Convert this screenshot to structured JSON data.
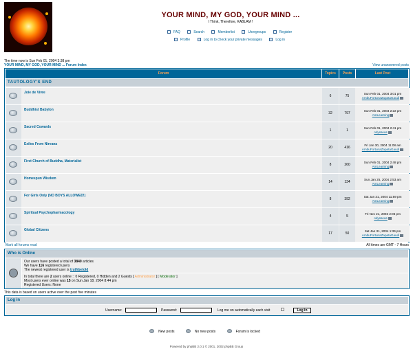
{
  "site": {
    "title": "YOUR MIND, MY GOD, YOUR MIND ...",
    "description": "I Think, Therefore, KABLAM !"
  },
  "nav": {
    "faq": "FAQ",
    "search": "Search",
    "memberlist": "Memberlist",
    "usergroups": "Usergroups",
    "register": "Register",
    "profile": "Profile",
    "messages": "Log in to check your private messages",
    "login": "Log in"
  },
  "timeline": "The time now is Sun Feb 01, 2004 3:38 pm",
  "breadcrumb": "YOUR MIND, MY GOD, YOUR MIND ... Forum Index",
  "unanswered": "View unanswered posts",
  "table": {
    "h_forum": "Forum",
    "h_topics": "Topics",
    "h_posts": "Posts",
    "h_last": "Last Post",
    "category": "TAUTOLOGY'S END"
  },
  "forums": [
    {
      "name": "Joie de Vivre",
      "topics": "6",
      "posts": "75",
      "date": "Sun Feb 01, 2004 3:01 pm",
      "user": "AmbuFortunaZapataGaudi"
    },
    {
      "name": "Buddhist Babylon",
      "topics": "32",
      "posts": "797",
      "date": "Sun Feb 01, 2004 2:22 pm",
      "user": "AmLearning"
    },
    {
      "name": "Sacred Cowards",
      "topics": "1",
      "posts": "1",
      "date": "Sun Feb 01, 2004 2:41 pm",
      "user": "odysseus"
    },
    {
      "name": "Exiles From Nirvana",
      "topics": "20",
      "posts": "416",
      "date": "Fri Jan 30, 2004 11:08 am",
      "user": "AmbuFortunaZapataGaudi"
    },
    {
      "name": "First Church of Buddha, Materialist",
      "topics": "8",
      "posts": "260",
      "date": "Sun Feb 01, 2004 2:48 pm",
      "user": "AmLearning"
    },
    {
      "name": "Homespun Wisdom",
      "topics": "14",
      "posts": "134",
      "date": "Sun Jan 25, 2004 2:53 am",
      "user": "AmLearning"
    },
    {
      "name": "For Girls Only (NO BOYS ALLOWED!)",
      "topics": "8",
      "posts": "392",
      "date": "Sat Jan 31, 2004 11:59 pm",
      "user": "AmLearning"
    },
    {
      "name": "Spiritual Psychopharmacology",
      "topics": "4",
      "posts": "5",
      "date": "Fri Nov 21, 2003 2:06 pm",
      "user": "odysseus"
    },
    {
      "name": "Global Citizens",
      "topics": "17",
      "posts": "50",
      "date": "Sat Jan 31, 2004 1:39 pm",
      "user": "AmbuFortunaZapataGaudi"
    }
  ],
  "mark_all": "Mark all forums read",
  "timezone": "All times are GMT - 7 Hours",
  "online": {
    "heading": "Who is Online",
    "l1a": "Our users have posted a total of ",
    "articles_count": "3840",
    "l1b": " articles",
    "l2a": "We have ",
    "users_count": "116",
    "l2b": " registered users",
    "l3a": "The newest registered user is ",
    "newest": "truthbetold",
    "l4a": "In total there are ",
    "online_count": "2",
    "l4b": " users online :: 0 Registered, 0 Hidden and 2 Guests   [ ",
    "admin": "Administrator",
    "l4c": " ]   [ ",
    "moderator": "Moderator",
    "l4d": " ]",
    "l5a": "Most users ever online was ",
    "most_count": "15",
    "l5b": " on Sun Jan 18, 2004 8:44 pm",
    "l6": "Registered Users: None"
  },
  "based": "This data is based on users active over the past five minutes",
  "login": {
    "heading": "Log in",
    "username": "Username:",
    "password": "Password:",
    "auto": "Log me on automatically each visit",
    "button": "Log in"
  },
  "legend": {
    "new": "New posts",
    "none": "No new posts",
    "locked": "Forum is locked"
  },
  "powered": "Powered by phpBB 2.0.1 © 2001, 2002 phpBB Group",
  "colors": {
    "header_bg": "#006699",
    "header_text": "#ffa34f",
    "title": "#660000",
    "row1": "#efefef",
    "row2": "#dee3e7",
    "cat": "#c7d0d7"
  }
}
